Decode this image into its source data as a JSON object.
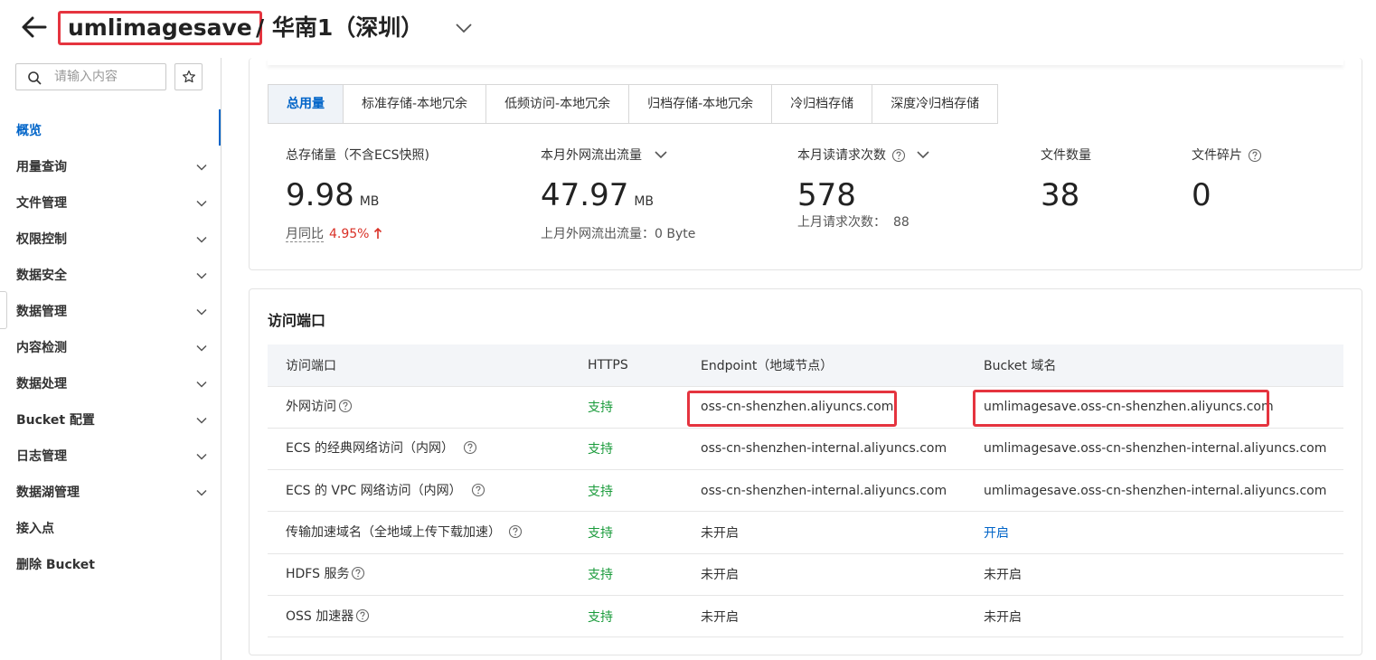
{
  "header": {
    "bucket_name": "umlimagesave",
    "region": "/ 华南1（深圳）"
  },
  "sidebar": {
    "search_placeholder": "请输入内容",
    "items": [
      {
        "label": "概览",
        "active": true,
        "expandable": false
      },
      {
        "label": "用量查询",
        "expandable": true
      },
      {
        "label": "文件管理",
        "expandable": true
      },
      {
        "label": "权限控制",
        "expandable": true
      },
      {
        "label": "数据安全",
        "expandable": true
      },
      {
        "label": "数据管理",
        "expandable": true
      },
      {
        "label": "内容检测",
        "expandable": true
      },
      {
        "label": "数据处理",
        "expandable": true
      },
      {
        "label": "Bucket 配置",
        "expandable": true
      },
      {
        "label": "日志管理",
        "expandable": true
      },
      {
        "label": "数据湖管理",
        "expandable": true
      },
      {
        "label": "接入点",
        "expandable": false
      },
      {
        "label": "删除 Bucket",
        "expandable": false
      }
    ]
  },
  "usage": {
    "tabs": [
      "总用量",
      "标准存储-本地冗余",
      "低频访问-本地冗余",
      "归档存储-本地冗余",
      "冷归档存储",
      "深度冷归档存储"
    ],
    "active_tab": 0,
    "stats": {
      "storage": {
        "title": "总存储量（不含ECS快照)",
        "value": "9.98",
        "unit": "MB",
        "mom_label": "月同比",
        "mom_value": "4.95%"
      },
      "outbound": {
        "title": "本月外网流出流量",
        "value": "47.97",
        "unit": "MB",
        "sub": "上月外网流出流量：0 Byte"
      },
      "requests": {
        "title": "本月读请求次数",
        "value": "578",
        "sub_label": "上月请求次数：",
        "sub_value": "88"
      },
      "files": {
        "title": "文件数量",
        "value": "38"
      },
      "fragments": {
        "title": "文件碎片",
        "value": "0"
      }
    }
  },
  "access": {
    "title": "访问端口",
    "columns": [
      "访问端口",
      "HTTPS",
      "Endpoint（地域节点）",
      "Bucket 域名"
    ],
    "rows": [
      {
        "port": "外网访问",
        "https": "支持",
        "endpoint": "oss-cn-shenzhen.aliyuncs.com",
        "domain": "umlimagesave.oss-cn-shenzhen.aliyuncs.com"
      },
      {
        "port": "ECS 的经典网络访问（内网）",
        "https": "支持",
        "endpoint": "oss-cn-shenzhen-internal.aliyuncs.com",
        "domain": "umlimagesave.oss-cn-shenzhen-internal.aliyuncs.com"
      },
      {
        "port": "ECS 的 VPC 网络访问（内网）",
        "https": "支持",
        "endpoint": "oss-cn-shenzhen-internal.aliyuncs.com",
        "domain": "umlimagesave.oss-cn-shenzhen-internal.aliyuncs.com"
      },
      {
        "port": "传输加速域名（全地域上传下载加速）",
        "https": "支持",
        "endpoint": "未开启",
        "domain": "开启"
      },
      {
        "port": "HDFS 服务",
        "https": "支持",
        "endpoint": "未开启",
        "domain": "未开启"
      },
      {
        "port": "OSS 加速器",
        "https": "支持",
        "endpoint": "未开启",
        "domain": "未开启"
      }
    ]
  },
  "colors": {
    "accent": "#0064c8",
    "highlight": "#e5343f",
    "support": "#1a9b3b",
    "increase": "#d93026"
  }
}
